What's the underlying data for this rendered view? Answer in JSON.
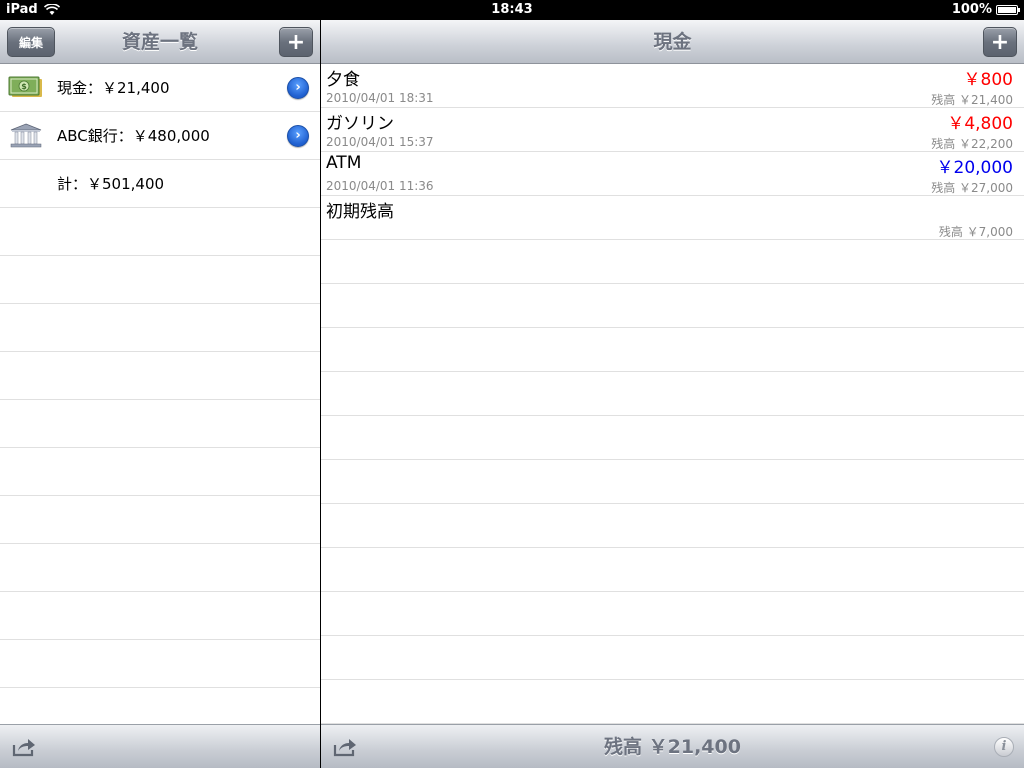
{
  "status": {
    "device": "iPad",
    "time": "18:43",
    "battery": "100%"
  },
  "left": {
    "title": "資産一覧",
    "edit_label": "編集",
    "add_label": "+",
    "assets": [
      {
        "label": "現金：￥21,400",
        "icon": "cash-icon"
      },
      {
        "label": "ABC銀行：￥480,000",
        "icon": "bank-icon"
      }
    ],
    "total": "計：￥501,400"
  },
  "right": {
    "title": "現金",
    "add_label": "+",
    "transactions": [
      {
        "name": "夕食",
        "amount": "￥800",
        "amount_color": "#ff0000",
        "date": "2010/04/01 18:31",
        "balance": "残高 ￥21,400"
      },
      {
        "name": "ガソリン",
        "amount": "￥4,800",
        "amount_color": "#ff0000",
        "date": "2010/04/01 15:37",
        "balance": "残高 ￥22,200"
      },
      {
        "name": "ATM",
        "amount": "￥20,000",
        "amount_color": "#0000ee",
        "date": "2010/04/01 11:36",
        "balance": "残高 ￥27,000"
      },
      {
        "name": "初期残高",
        "amount": "",
        "date": "",
        "balance": "残高 ￥7,000"
      }
    ],
    "footer_balance": "残高 ￥21,400",
    "info_label": "i"
  }
}
